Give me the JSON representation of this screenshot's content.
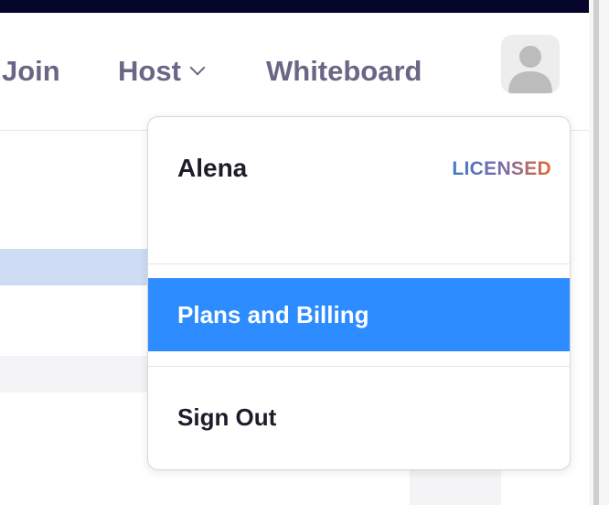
{
  "nav": {
    "join_label": "Join",
    "host_label": "Host",
    "whiteboard_label": "Whiteboard"
  },
  "menu": {
    "user_name": "Alena",
    "license_badge": "LICENSED",
    "plans_label": "Plans and Billing",
    "signout_label": "Sign Out"
  },
  "colors": {
    "nav_text": "#6b6685",
    "highlight": "#2d8cff",
    "top_bar": "#05042a"
  },
  "icons": {
    "avatar": "user-avatar-icon",
    "host_chevron": "chevron-down-icon"
  }
}
